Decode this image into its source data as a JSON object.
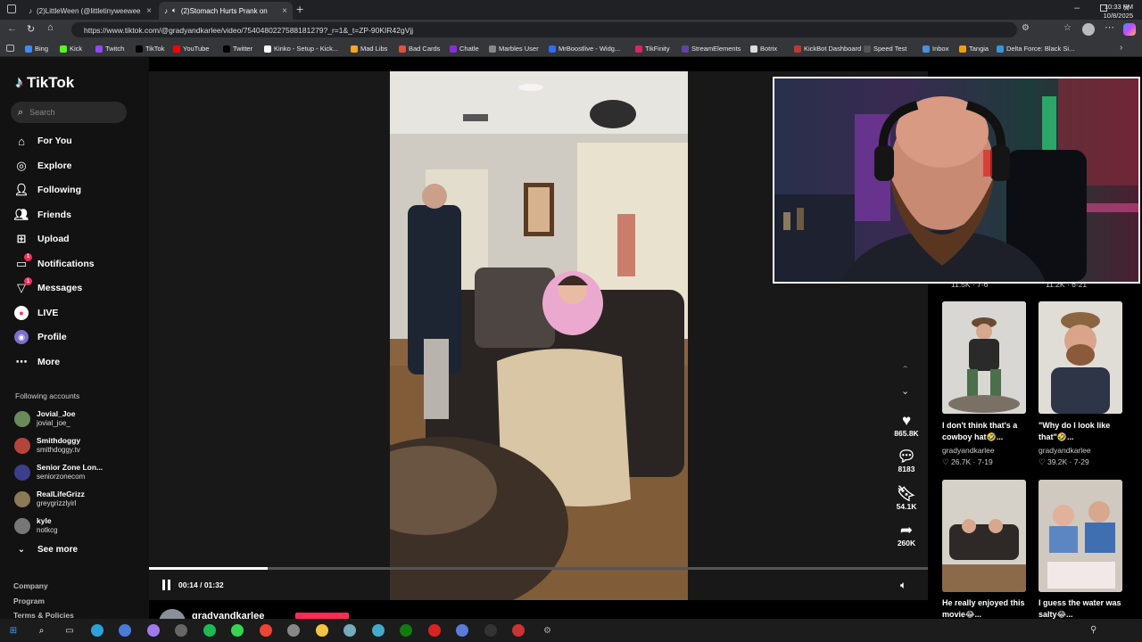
{
  "browser": {
    "tabs": [
      {
        "label": "(2)LittleWeen (@littletinyweewee",
        "active": false
      },
      {
        "label": "(2)Stomach Hurts Prank on",
        "active": true
      }
    ],
    "url": "https://www.tiktok.com/@gradyandkarlee/video/7540480227588181279?_r=1&_t=ZP-90KIR42gVjj",
    "bookmarks": [
      "Bing",
      "Kick",
      "Twitch",
      "TikTok",
      "YouTube",
      "Twitter",
      "Kinko - Setup - Kick...",
      "Mad Libs",
      "Bad Cards",
      "Chatle",
      "Marbles User",
      "MrBoostlive - Widg...",
      "TikFinity",
      "StreamElements",
      "Botrix",
      "KickBot Dashboard",
      "Speed Test",
      "Inbox",
      "Tangia",
      "Delta Force: Black Si..."
    ]
  },
  "tiktok": {
    "logo": "TikTok",
    "search_placeholder": "Search",
    "nav": [
      {
        "label": "For You",
        "icon": "home-icon"
      },
      {
        "label": "Explore",
        "icon": "compass-icon"
      },
      {
        "label": "Following",
        "icon": "following-icon"
      },
      {
        "label": "Friends",
        "icon": "friends-icon"
      },
      {
        "label": "Upload",
        "icon": "upload-icon"
      },
      {
        "label": "Notifications",
        "icon": "inbox-icon",
        "badge": "1"
      },
      {
        "label": "Messages",
        "icon": "messages-icon",
        "badge": "1"
      },
      {
        "label": "LIVE",
        "icon": "live-icon"
      },
      {
        "label": "Profile",
        "icon": "profile-icon"
      },
      {
        "label": "More",
        "icon": "more-icon"
      }
    ],
    "following_title": "Following accounts",
    "accounts": [
      {
        "name": "Jovial_Joe",
        "handle": "jovial_joe_"
      },
      {
        "name": "Smithdoggy",
        "handle": "smithdoggy.tv"
      },
      {
        "name": "Senior Zone Lon...",
        "handle": "seniorzonecom"
      },
      {
        "name": "RealLifeGrizz",
        "handle": "greygrizzlyirl"
      },
      {
        "name": "kyle",
        "handle": "notkcg"
      }
    ],
    "see_more": "See more",
    "footer": [
      "Company",
      "Program",
      "Terms & Policies"
    ],
    "player": {
      "time": "00:14 / 01:32",
      "progress": 0.152
    },
    "creator_bottom": "gradyandkarlee",
    "actions": [
      {
        "icon": "heart-icon",
        "count": "865.8K"
      },
      {
        "icon": "comment-icon",
        "count": "8183"
      },
      {
        "icon": "bookmark-icon",
        "count": "54.1K"
      },
      {
        "icon": "share-icon",
        "count": "260K"
      }
    ],
    "related": [
      {
        "caption": "I don't think that's a cowboy hat🤣...",
        "creator": "gradyandkarlee",
        "stats": "♡ 26.7K · 7-19"
      },
      {
        "caption": "\"Why do I look like that\"🤣...",
        "creator": "gradyandkarlee",
        "stats": "♡ 39.2K · 7-29"
      },
      {
        "caption": "He really enjoyed this movie😂...",
        "creator": "",
        "stats": ""
      },
      {
        "caption": "I guess the water was salty😂...",
        "creator": "",
        "stats": ""
      }
    ],
    "partial_stats": [
      "11.5K · 7-6",
      "11.2K · 6-21"
    ]
  },
  "taskbar": {
    "time": "10:33 PM",
    "date": "10/8/2025"
  }
}
